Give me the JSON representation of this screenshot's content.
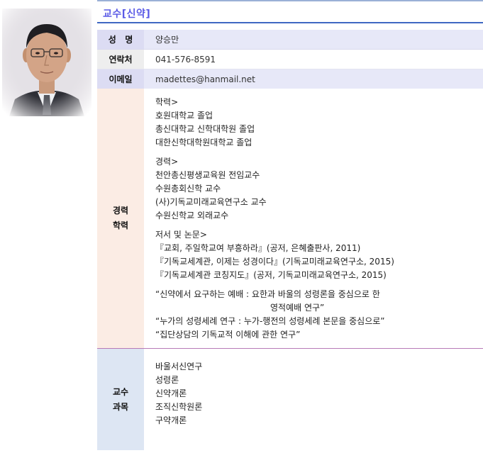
{
  "title": "교수[신약]",
  "profile": {
    "name_label": "성   명",
    "name": "양승만",
    "phone_label": "연락처",
    "phone": "041-576-8591",
    "email_label": "이메일",
    "email": "madettes@hanmail.net"
  },
  "career": {
    "label_line1": "경력",
    "label_line2": "학력",
    "education_header": "학력>",
    "education": [
      "호원대학교 졸업",
      "총신대학교 신학대학원 졸업",
      "대한신학대학원대학교 졸업"
    ],
    "experience_header": "경력>",
    "experience": [
      "천안총신평생교육원 전임교수",
      "수원총회신학 교수",
      "(사)기독교미래교육연구소 교수",
      "수원신학교 외래교수"
    ],
    "publications_header": "저서 및 논문>",
    "publications": [
      "『교회, 주일학교여 부흥하라』(공저, 은혜출판사, 2011)",
      "『기독교세계관, 이제는 성경이다』(기독교미래교육연구소, 2015)",
      "『기독교세계관 코칭지도』(공저, 기독교미래교육연구소, 2015)"
    ],
    "papers": [
      "“신약에서 요구하는 예배 : 요한과 바울의 성령론을 중심으로 한",
      "영적예배 연구”",
      "“누가의 성령세례 연구 : 누가-행전의 성령세례 본문을 중심으로”",
      "“집단상담의 기독교적 이해에 관한 연구”"
    ]
  },
  "courses": {
    "label_line1": "교수",
    "label_line2": "과목",
    "items": [
      "바울서신연구",
      "성령론",
      "신약개론",
      "조직신학원론",
      "구약개론"
    ]
  }
}
